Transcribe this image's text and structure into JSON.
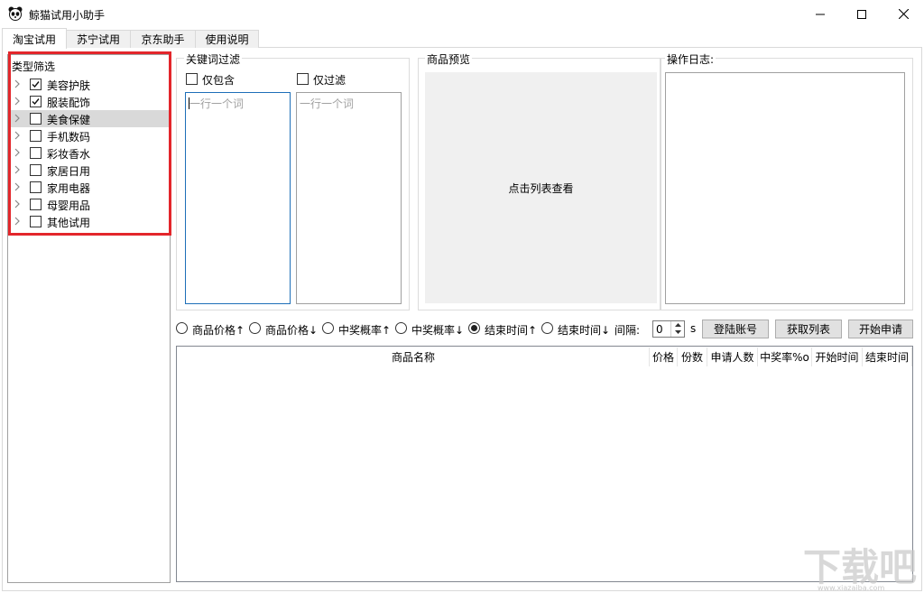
{
  "window": {
    "title": "鲸猫试用小助手",
    "icon": "panda-icon",
    "controls": [
      "minimize-icon",
      "maximize-icon",
      "close-icon"
    ]
  },
  "tabs": [
    {
      "label": "淘宝试用",
      "active": true
    },
    {
      "label": "苏宁试用",
      "active": false
    },
    {
      "label": "京东助手",
      "active": false
    },
    {
      "label": "使用说明",
      "active": false
    }
  ],
  "category_filter": {
    "title": "类型筛选",
    "items": [
      {
        "label": "美容护肤",
        "checked": true,
        "selected": false
      },
      {
        "label": "服装配饰",
        "checked": true,
        "selected": false
      },
      {
        "label": "美食保健",
        "checked": false,
        "selected": true
      },
      {
        "label": "手机数码",
        "checked": false,
        "selected": false
      },
      {
        "label": "彩妆香水",
        "checked": false,
        "selected": false
      },
      {
        "label": "家居日用",
        "checked": false,
        "selected": false
      },
      {
        "label": "家用电器",
        "checked": false,
        "selected": false
      },
      {
        "label": "母婴用品",
        "checked": false,
        "selected": false
      },
      {
        "label": "其他试用",
        "checked": false,
        "selected": false
      }
    ]
  },
  "keyword_filter": {
    "title": "关键词过滤",
    "include_label": "仅包含",
    "include_checked": false,
    "include_placeholder": "一行一个词",
    "exclude_label": "仅过滤",
    "exclude_checked": false,
    "exclude_placeholder": "一行一个词"
  },
  "preview": {
    "title": "商品预览",
    "hint": "点击列表查看"
  },
  "log": {
    "title": "操作日志:"
  },
  "sort_options": [
    {
      "label": "商品价格↑",
      "checked": false
    },
    {
      "label": "商品价格↓",
      "checked": false
    },
    {
      "label": "中奖概率↑",
      "checked": false
    },
    {
      "label": "中奖概率↓",
      "checked": false
    },
    {
      "label": "结束时间↑",
      "checked": true
    },
    {
      "label": "结束时间↓",
      "checked": false
    }
  ],
  "interval": {
    "label": "间隔:",
    "value": "0",
    "unit": "s"
  },
  "buttons": {
    "login": "登陆账号",
    "fetch": "获取列表",
    "start": "开始申请"
  },
  "table": {
    "columns": [
      "商品名称",
      "价格",
      "份数",
      "申请人数",
      "中奖率%o",
      "开始时间",
      "结束时间"
    ],
    "rows": []
  },
  "colors": {
    "highlight": "#e3262b",
    "selected_row": "#d9d9d9",
    "preview_bg": "#f0f0f0"
  }
}
